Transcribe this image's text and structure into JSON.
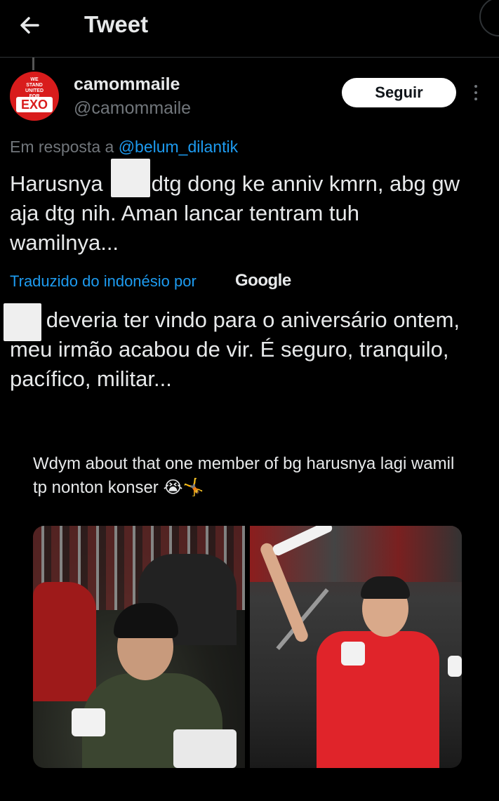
{
  "header": {
    "title": "Tweet",
    "back_icon": "arrow-left-icon"
  },
  "author": {
    "display_name": "camommaile",
    "handle": "@camommaile",
    "avatar_text": {
      "lines": [
        "WE",
        "STAND",
        "UNITED",
        "FOR"
      ],
      "big": "EXO"
    },
    "follow_label": "Seguir"
  },
  "tweet": {
    "reply_prefix": "Em resposta a",
    "reply_mention": "@belum_dilantik",
    "text": "Harusnya        dtg dong ke anniv kmrn, abg gw aja dtg nih. Aman lancar tentram tuh wamilnya...",
    "translation_label": "Traduzido do indonésio por",
    "translation_provider": "Google",
    "translated_text": "      deveria ter vindo para o aniversário ontem, meu irmão acabou de vir. É seguro, tranquilo, pacífico, militar..."
  },
  "quoted": {
    "text": "Wdym about that one member of bg harusnya lagi wamil tp nonton konser 😭🤸"
  },
  "colors": {
    "background": "#000000",
    "link": "#1d9bf0",
    "muted": "#71767b",
    "avatar_red": "#d91c1c"
  }
}
